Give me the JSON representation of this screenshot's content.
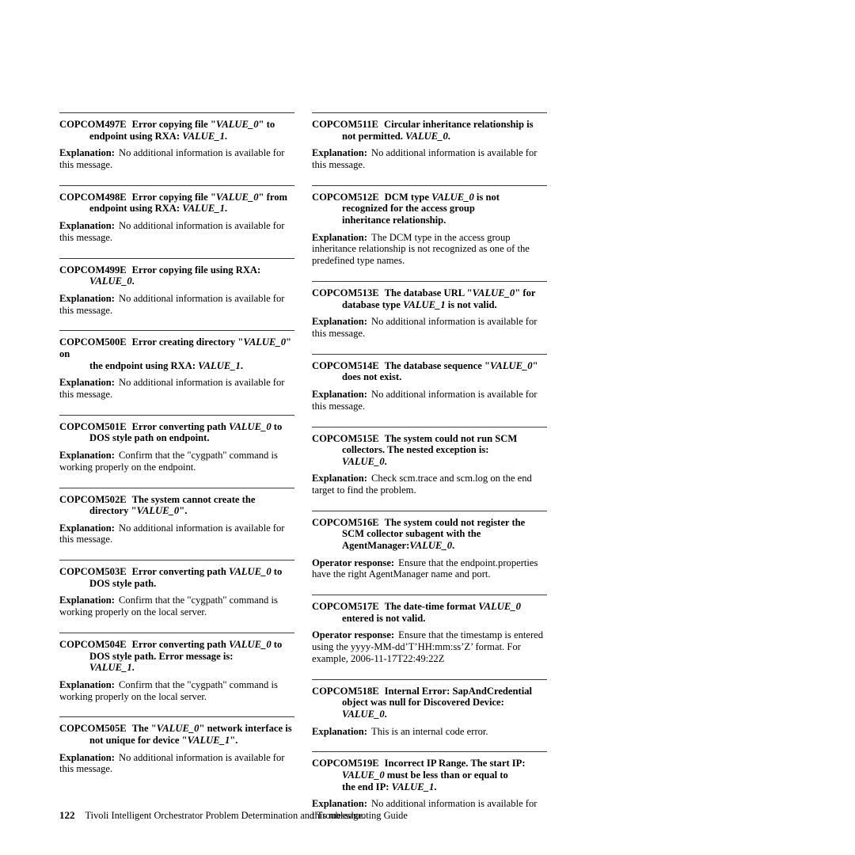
{
  "footer": {
    "page_number": "122",
    "title": "Tivoli Intelligent Orchestrator Problem Determination and Troubleshooting Guide"
  },
  "labels": {
    "explanation": "Explanation:",
    "operator_response": "Operator response:"
  },
  "left_column": [
    {
      "id": "COPCOM497E",
      "lines": [
        [
          {
            "t": "Error copying file \"",
            "s": "b"
          },
          {
            "t": "VALUE_0",
            "s": "i"
          },
          {
            "t": "\" to",
            "s": "b"
          }
        ],
        [
          {
            "t": "endpoint using RXA: ",
            "s": "b"
          },
          {
            "t": "VALUE_1",
            "s": "i"
          },
          {
            "t": ".",
            "s": "b"
          }
        ]
      ],
      "body_label": "Explanation:",
      "body_text": "No additional information is available for this message."
    },
    {
      "id": "COPCOM498E",
      "lines": [
        [
          {
            "t": "Error copying file \"",
            "s": "b"
          },
          {
            "t": "VALUE_0",
            "s": "i"
          },
          {
            "t": "\" from",
            "s": "b"
          }
        ],
        [
          {
            "t": "endpoint using RXA: ",
            "s": "b"
          },
          {
            "t": "VALUE_1",
            "s": "i"
          },
          {
            "t": ".",
            "s": "b"
          }
        ]
      ],
      "body_label": "Explanation:",
      "body_text": "No additional information is available for this message."
    },
    {
      "id": "COPCOM499E",
      "lines": [
        [
          {
            "t": "Error copying file using RXA:",
            "s": "b"
          }
        ],
        [
          {
            "t": "VALUE_0",
            "s": "i"
          },
          {
            "t": ".",
            "s": "b"
          }
        ]
      ],
      "body_label": "Explanation:",
      "body_text": "No additional information is available for this message."
    },
    {
      "id": "COPCOM500E",
      "lines": [
        [
          {
            "t": "Error creating directory \"",
            "s": "b"
          },
          {
            "t": "VALUE_0",
            "s": "i"
          },
          {
            "t": "\" on",
            "s": "b"
          }
        ],
        [
          {
            "t": "the endpoint using RXA: ",
            "s": "b"
          },
          {
            "t": "VALUE_1",
            "s": "i"
          },
          {
            "t": ".",
            "s": "b"
          }
        ]
      ],
      "body_label": "Explanation:",
      "body_text": "No additional information is available for this message."
    },
    {
      "id": "COPCOM501E",
      "lines": [
        [
          {
            "t": "Error converting path ",
            "s": "b"
          },
          {
            "t": "VALUE_0",
            "s": "i"
          },
          {
            "t": " to",
            "s": "b"
          }
        ],
        [
          {
            "t": "DOS style path on endpoint.",
            "s": "b"
          }
        ]
      ],
      "body_label": "Explanation:",
      "body_text": "Confirm that the \"cygpath\" command is working properly on the endpoint."
    },
    {
      "id": "COPCOM502E",
      "lines": [
        [
          {
            "t": "The system cannot create the",
            "s": "b"
          }
        ],
        [
          {
            "t": "directory \"",
            "s": "b"
          },
          {
            "t": "VALUE_0",
            "s": "i"
          },
          {
            "t": "\".",
            "s": "b"
          }
        ]
      ],
      "body_label": "Explanation:",
      "body_text": "No additional information is available for this message."
    },
    {
      "id": "COPCOM503E",
      "lines": [
        [
          {
            "t": "Error converting path ",
            "s": "b"
          },
          {
            "t": "VALUE_0",
            "s": "i"
          },
          {
            "t": " to",
            "s": "b"
          }
        ],
        [
          {
            "t": "DOS style path.",
            "s": "b"
          }
        ]
      ],
      "body_label": "Explanation:",
      "body_text": "Confirm that the \"cygpath\" command is working properly on the local server."
    },
    {
      "id": "COPCOM504E",
      "lines": [
        [
          {
            "t": "Error converting path ",
            "s": "b"
          },
          {
            "t": "VALUE_0",
            "s": "i"
          },
          {
            "t": " to",
            "s": "b"
          }
        ],
        [
          {
            "t": "DOS style path. Error message is:",
            "s": "b"
          }
        ],
        [
          {
            "t": "VALUE_1",
            "s": "i"
          },
          {
            "t": ".",
            "s": "b"
          }
        ]
      ],
      "body_label": "Explanation:",
      "body_text": "Confirm that the \"cygpath\" command is working properly on the local server."
    },
    {
      "id": "COPCOM505E",
      "lines": [
        [
          {
            "t": "The \"",
            "s": "b"
          },
          {
            "t": "VALUE_0",
            "s": "i"
          },
          {
            "t": "\" network interface is",
            "s": "b"
          }
        ],
        [
          {
            "t": "not unique for device \"",
            "s": "b"
          },
          {
            "t": "VALUE_1",
            "s": "i"
          },
          {
            "t": "\".",
            "s": "b"
          }
        ]
      ],
      "body_label": "Explanation:",
      "body_text": "No additional information is available for this message."
    }
  ],
  "right_column": [
    {
      "id": "COPCOM511E",
      "lines": [
        [
          {
            "t": "Circular inheritance relationship is",
            "s": "b"
          }
        ],
        [
          {
            "t": "not permitted. ",
            "s": "b"
          },
          {
            "t": "VALUE_0",
            "s": "i"
          },
          {
            "t": ".",
            "s": "b"
          }
        ]
      ],
      "body_label": "Explanation:",
      "body_text": "No additional information is available for this message."
    },
    {
      "id": "COPCOM512E",
      "lines": [
        [
          {
            "t": "DCM type ",
            "s": "b"
          },
          {
            "t": "VALUE_0",
            "s": "i"
          },
          {
            "t": " is not",
            "s": "b"
          }
        ],
        [
          {
            "t": "recognized for the access group",
            "s": "b"
          }
        ],
        [
          {
            "t": "inheritance relationship.",
            "s": "b"
          }
        ]
      ],
      "body_label": "Explanation:",
      "body_text": "The DCM type in the access group inheritance relationship is not recognized as one of the predefined type names."
    },
    {
      "id": "COPCOM513E",
      "lines": [
        [
          {
            "t": "The database URL \"",
            "s": "b"
          },
          {
            "t": "VALUE_0",
            "s": "i"
          },
          {
            "t": "\" for",
            "s": "b"
          }
        ],
        [
          {
            "t": "database type ",
            "s": "b"
          },
          {
            "t": "VALUE_1",
            "s": "i"
          },
          {
            "t": " is not valid.",
            "s": "b"
          }
        ]
      ],
      "body_label": "Explanation:",
      "body_text": "No additional information is available for this message."
    },
    {
      "id": "COPCOM514E",
      "lines": [
        [
          {
            "t": "The database sequence \"",
            "s": "b"
          },
          {
            "t": "VALUE_0",
            "s": "i"
          },
          {
            "t": "\"",
            "s": "b"
          }
        ],
        [
          {
            "t": "does not exist.",
            "s": "b"
          }
        ]
      ],
      "body_label": "Explanation:",
      "body_text": "No additional information is available for this message."
    },
    {
      "id": "COPCOM515E",
      "lines": [
        [
          {
            "t": "The system could not run SCM",
            "s": "b"
          }
        ],
        [
          {
            "t": "collectors. The nested exception is:",
            "s": "b"
          }
        ],
        [
          {
            "t": "VALUE_0",
            "s": "i"
          },
          {
            "t": ".",
            "s": "b"
          }
        ]
      ],
      "body_label": "Explanation:",
      "body_text": "Check scm.trace and scm.log on the end target to find the problem."
    },
    {
      "id": "COPCOM516E",
      "lines": [
        [
          {
            "t": "The system could not register the",
            "s": "b"
          }
        ],
        [
          {
            "t": "SCM collector subagent with the",
            "s": "b"
          }
        ],
        [
          {
            "t": "AgentManager:",
            "s": "b"
          },
          {
            "t": "VALUE_0",
            "s": "i"
          },
          {
            "t": ".",
            "s": "b"
          }
        ]
      ],
      "body_label": "Operator response:",
      "body_text": "Ensure that the endpoint.properties have the right AgentManager name and port."
    },
    {
      "id": "COPCOM517E",
      "lines": [
        [
          {
            "t": "The date-time format ",
            "s": "b"
          },
          {
            "t": "VALUE_0",
            "s": "i"
          }
        ],
        [
          {
            "t": "entered is not valid.",
            "s": "b"
          }
        ]
      ],
      "body_label": "Operator response:",
      "body_text": "Ensure that the timestamp is entered using the yyyy-MM-dd’T’HH:mm:ss’Z’ format. For example, 2006-11-17T22:49:22Z"
    },
    {
      "id": "COPCOM518E",
      "lines": [
        [
          {
            "t": "Internal Error: SapAndCredential",
            "s": "b"
          }
        ],
        [
          {
            "t": "object was null for Discovered Device:",
            "s": "b"
          }
        ],
        [
          {
            "t": "VALUE_0",
            "s": "i"
          },
          {
            "t": ".",
            "s": "b"
          }
        ]
      ],
      "body_label": "Explanation:",
      "body_text": "This is an internal code error."
    },
    {
      "id": "COPCOM519E",
      "lines": [
        [
          {
            "t": "Incorrect IP Range. The start IP:",
            "s": "b"
          }
        ],
        [
          {
            "t": "VALUE_0",
            "s": "i"
          },
          {
            "t": " must be less than or equal to",
            "s": "b"
          }
        ],
        [
          {
            "t": "the end IP: ",
            "s": "b"
          },
          {
            "t": "VALUE_1",
            "s": "i"
          },
          {
            "t": ".",
            "s": "b"
          }
        ]
      ],
      "body_label": "Explanation:",
      "body_text": "No additional information is available for this message."
    }
  ]
}
